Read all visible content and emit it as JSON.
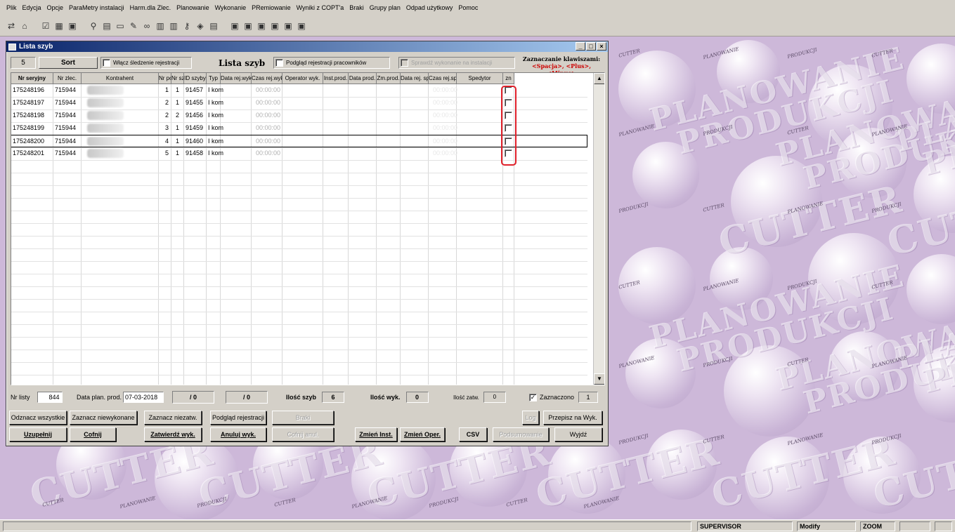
{
  "menu": [
    "Plik",
    "Edycja",
    "Opcje",
    "ParaMetry instalacji",
    "Harm.dla Zlec.",
    "Planowanie",
    "Wykonanie",
    "PRemiowanie",
    "Wyniki z COPT'a",
    "Braki",
    "Grupy plan",
    "Odpad użytkowy",
    "Pomoc"
  ],
  "window": {
    "title": "Lista szyb",
    "count_box": "5",
    "sort_label": "Sort",
    "wlacz_label": "Włącz śledzenie rejestracji",
    "list_title": "Lista szyb",
    "podglad_label": "Podgląd rejestracji pracowników",
    "sprawdz_label": "Sprawdź wykonanie na instalacji",
    "hotkeys_title": "Zaznaczanie klawiszami:",
    "hotkeys_keys": "<Spacja>, <Plus>, <Minus>"
  },
  "columns": [
    "Nr seryjny",
    "Nr zlec.",
    "Kontrahent",
    "Nr poz",
    "Nr szt.",
    "ID szyby",
    "Typ",
    "Data rej.wyk.",
    "Czas rej.wyk.",
    "Operator wyk.",
    "Inst.prod.",
    "Data prod.",
    "Zm.prod.",
    "Data rej. sp.",
    "Czas rej.sp.",
    "Spedytor",
    "zn"
  ],
  "rows": [
    {
      "serial": "175248196",
      "order": "715944",
      "poz": "1",
      "szt": "1",
      "id": "91457",
      "typ": "I kom",
      "time": "00:00:00",
      "time_sp": "00:00:00"
    },
    {
      "serial": "175248197",
      "order": "715944",
      "poz": "2",
      "szt": "1",
      "id": "91455",
      "typ": "I kom",
      "time": "00:00:00",
      "time_sp": "00:00:00"
    },
    {
      "serial": "175248198",
      "order": "715944",
      "poz": "2",
      "szt": "2",
      "id": "91456",
      "typ": "I kom",
      "time": "00:00:00",
      "time_sp": "00:00:00"
    },
    {
      "serial": "175248199",
      "order": "715944",
      "poz": "3",
      "szt": "1",
      "id": "91459",
      "typ": "I kom",
      "time": "00:00:00",
      "time_sp": "00:00:00"
    },
    {
      "serial": "175248200",
      "order": "715944",
      "poz": "4",
      "szt": "1",
      "id": "91460",
      "typ": "I kom",
      "time": "00:00:00",
      "time_sp": "00:00:00"
    },
    {
      "serial": "175248201",
      "order": "715944",
      "poz": "5",
      "szt": "1",
      "id": "91458",
      "typ": "I kom",
      "time": "00:00:00",
      "time_sp": "00:00:00"
    }
  ],
  "bottom": {
    "nr_listy_label": "Nr listy",
    "nr_listy": "844",
    "data_plan_label": "Data plan. prod.",
    "data_plan": "07-03-2018",
    "box1": "/ 0",
    "box2": "/ 0",
    "ilosc_szyb_label": "Ilość szyb",
    "ilosc_szyb": "6",
    "ilosc_wyk_label": "Ilość wyk.",
    "ilosc_wyk": "0",
    "ilosc_zatw_label": "Ilość zatw.",
    "ilosc_zatw": "0",
    "zaznaczono_label": "Zaznaczono",
    "zaznaczono": "1"
  },
  "buttons": {
    "odznacz": "Odznacz wszystkie",
    "zazn_niewyk": "Zaznacz niewykonane",
    "zazn_niezatw": "Zaznacz niezatw.",
    "podglad_rej": "Podgląd rejestracji",
    "braki": "Braki",
    "log": "Log",
    "przepisz": "Przepisz na Wyk.",
    "uzupelnij": "Uzupełnij",
    "cofnij": "Cofnij",
    "zatwierdz": "Zatwierdź wyk.",
    "anuluj": "Anuluj wyk.",
    "cofnij_anul": "Cofnij anul.",
    "zmien_inst": "Zmień Inst.",
    "zmien_oper": "Zmień Oper.",
    "csv": "CSV",
    "podsumowanie": "Podsumowanie",
    "wyjdz": "Wyjdź"
  },
  "watermark": {
    "line1": "PLANOWANIE",
    "line2": "PRODUKCJI",
    "cutter": "CUTTER",
    "small_cutter": "CUTTER",
    "small_plan": "PLANOWANIE",
    "small_prod": "PRODUKCJI"
  },
  "status": {
    "user": "SUPERVISOR",
    "mode": "Modify",
    "zoom": "ZOOM"
  },
  "colors": {
    "title_start": "#0a246a",
    "title_end": "#a6caf0",
    "highlight": "#e0202a",
    "desktop": "#cdb8d9",
    "hotkeys_keys": "#cc0000"
  }
}
